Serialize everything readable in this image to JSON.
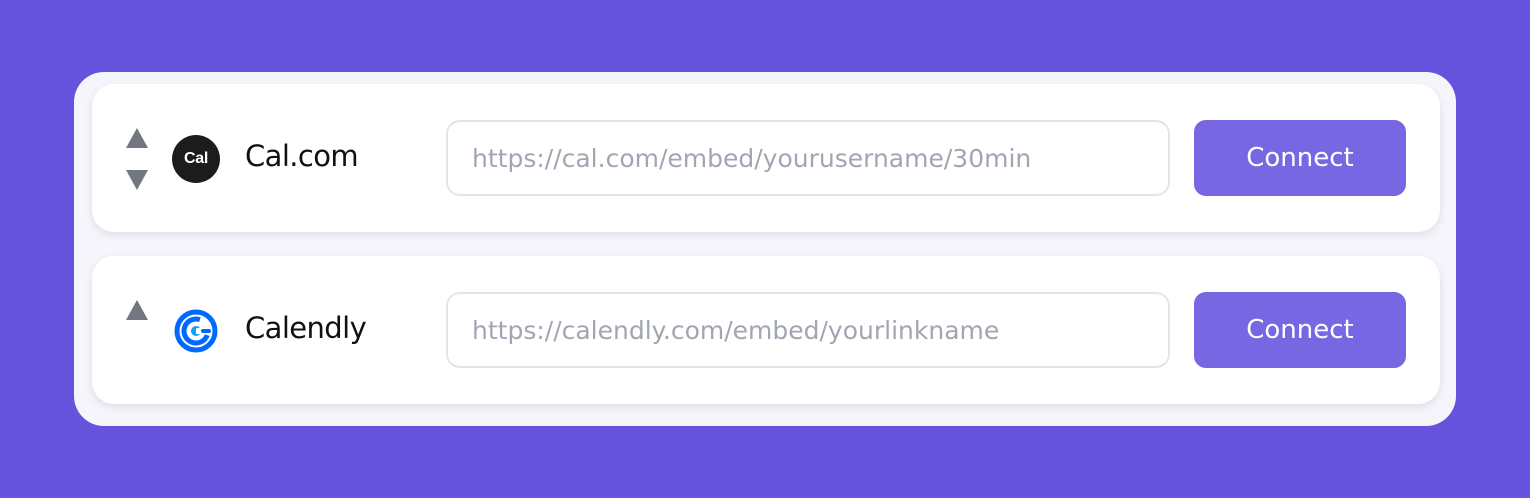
{
  "integrations": [
    {
      "name": "Cal.com",
      "logo_text": "Cal",
      "logo_icon": "cal-com-logo",
      "arrows": [
        "move-up",
        "move-down"
      ],
      "url_placeholder": "https://cal.com/embed/yourusername/30min",
      "url_value": "",
      "button_label": "Connect"
    },
    {
      "name": "Calendly",
      "logo_icon": "calendly-logo",
      "arrows": [
        "move-up"
      ],
      "url_placeholder": "https://calendly.com/embed/yourlinkname",
      "url_value": "",
      "button_label": "Connect"
    }
  ],
  "colors": {
    "background": "#6553dd",
    "accent": "#7767e2",
    "calendly_blue": "#0069ff"
  }
}
